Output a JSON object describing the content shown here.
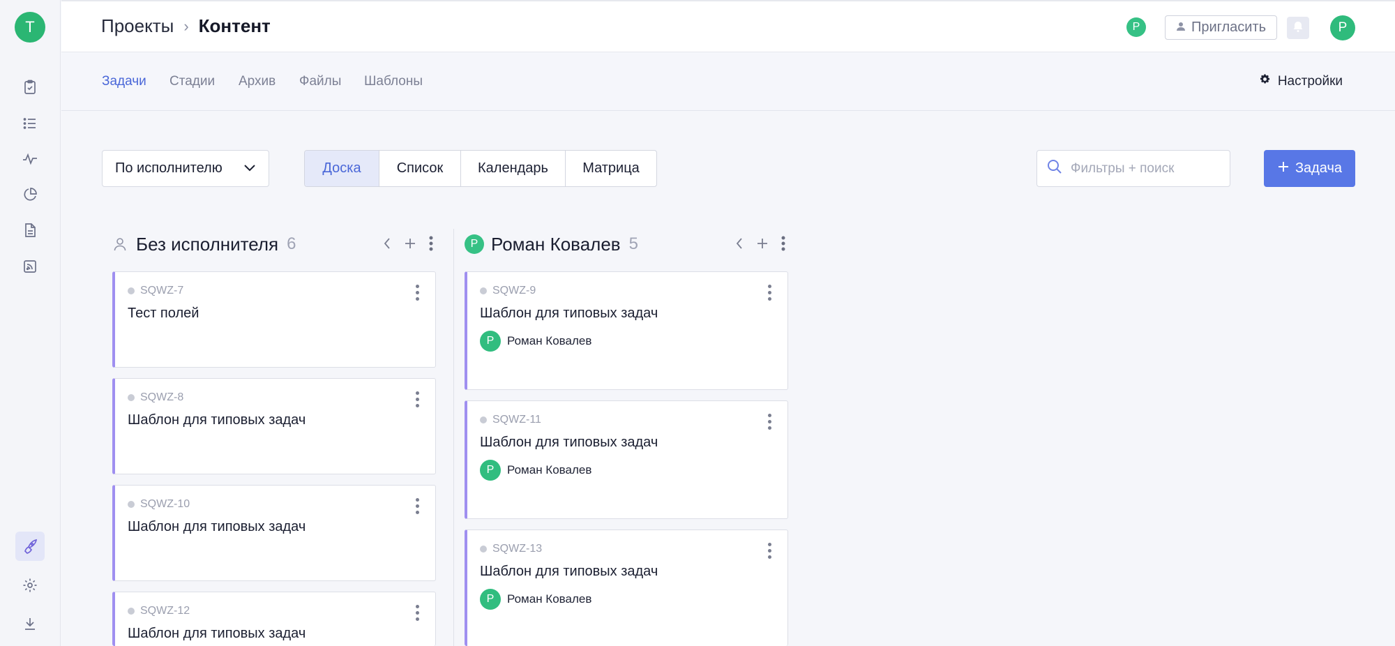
{
  "workspace": {
    "avatar_letter": "T"
  },
  "breadcrumb": {
    "parent": "Проекты",
    "separator": "›",
    "current": "Контент"
  },
  "header": {
    "member_avatar_letter": "Р",
    "invite_label": "Пригласить",
    "user_avatar_letter": "Р"
  },
  "tabs": [
    {
      "label": "Задачи",
      "active": true
    },
    {
      "label": "Стадии"
    },
    {
      "label": "Архив"
    },
    {
      "label": "Файлы"
    },
    {
      "label": "Шаблоны"
    }
  ],
  "settings_label": "Настройки",
  "toolbar": {
    "group_by": "По исполнителю",
    "views": [
      "Доска",
      "Список",
      "Календарь",
      "Матрица"
    ],
    "active_view": "Доска",
    "search_placeholder": "Фильтры + поиск",
    "add_task_label": "Задача"
  },
  "columns": [
    {
      "title": "Без исполнителя",
      "count": "6",
      "cards": [
        {
          "id": "SQWZ-7",
          "title": "Тест полей"
        },
        {
          "id": "SQWZ-8",
          "title": "Шаблон для типовых задач"
        },
        {
          "id": "SQWZ-10",
          "title": "Шаблон для типовых задач"
        },
        {
          "id": "SQWZ-12",
          "title": "Шаблон для типовых задач"
        }
      ]
    },
    {
      "title": "Роман Ковалев",
      "avatar_letter": "Р",
      "count": "5",
      "cards": [
        {
          "id": "SQWZ-9",
          "title": "Шаблон для типовых задач",
          "assignee": "Роман Ковалев",
          "assignee_letter": "Р"
        },
        {
          "id": "SQWZ-11",
          "title": "Шаблон для типовых задач",
          "assignee": "Роман Ковалев",
          "assignee_letter": "Р"
        },
        {
          "id": "SQWZ-13",
          "title": "Шаблон для типовых задач",
          "assignee": "Роман Ковалев",
          "assignee_letter": "Р"
        }
      ]
    }
  ],
  "colors": {
    "accent": "#5877e6",
    "avatar_green": "#2fbb7c",
    "card_stripe": "#9f8ff0"
  }
}
